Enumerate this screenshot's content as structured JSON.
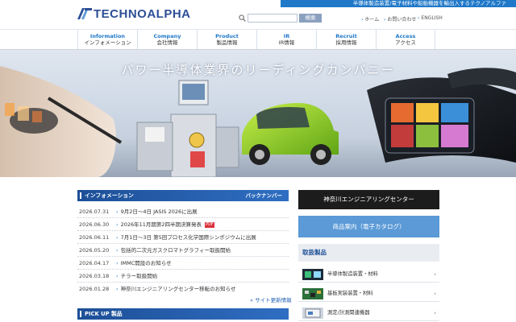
{
  "header": {
    "logo_text": "TECHNOALPHA",
    "tagline": "半導体製造装置/電子材料や船舶機器を輸出入するテクノアルファ",
    "search_button": "検索",
    "search_placeholder": "",
    "links": [
      "ホーム",
      "お問い合わせ",
      "ENGLISH"
    ]
  },
  "nav": [
    {
      "en": "Information",
      "jp": "インフォメーション"
    },
    {
      "en": "Company",
      "jp": "会社情報"
    },
    {
      "en": "Product",
      "jp": "製品情報"
    },
    {
      "en": "IR",
      "jp": "IR情報"
    },
    {
      "en": "Recruit",
      "jp": "採用情報"
    },
    {
      "en": "Access",
      "jp": "アクセス"
    }
  ],
  "hero": {
    "title": "パワー半導体業界のリーディングカンパニー"
  },
  "info": {
    "heading": "インフォメーション",
    "back_number": "バックナンバー",
    "items": [
      {
        "date": "2026.07.31",
        "title": "9月2日～4日 JASIS 2026に出展"
      },
      {
        "date": "2026.06.30",
        "title": "2026年11月期第2四半期決算発表",
        "pdf": "PDF"
      },
      {
        "date": "2026.06.11",
        "title": "7月1日～3日 第5回プロセス化学国際シンポジウムに出展"
      },
      {
        "date": "2026.05.20",
        "title": "包括的二次元ガスクロマトグラフィー取扱開始"
      },
      {
        "date": "2026.04.17",
        "title": "IMMC開設のお知らせ"
      },
      {
        "date": "2026.03.18",
        "title": "チラー取扱開始"
      },
      {
        "date": "2026.01.28",
        "title": "神奈川エンジニアリングセンター移転のお知らせ"
      }
    ],
    "more": "サイト更新情報"
  },
  "pickup": {
    "heading": "PICK UP 製品"
  },
  "side": {
    "engineering_center": "神奈川エンジニアリングセンター",
    "catalog": "商品案内（電子カタログ）",
    "products_heading": "取扱製品",
    "products": [
      {
        "label": "半導体製造装置・材料"
      },
      {
        "label": "基板実装装置・材料"
      },
      {
        "label": "測定/計測関連機器"
      }
    ]
  },
  "colors": {
    "brand_blue": "#1d4f97",
    "accent_blue": "#1f78c8",
    "catalog_blue": "#5b9ad6"
  }
}
